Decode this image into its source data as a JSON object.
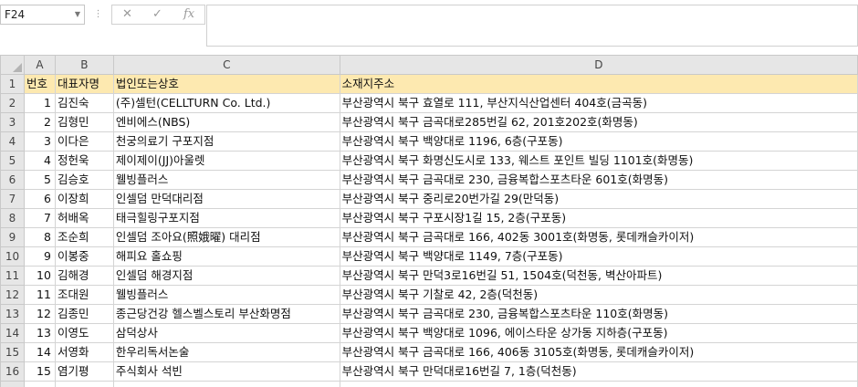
{
  "namebox": {
    "value": "F24"
  },
  "formula": {
    "cancel_icon": "✕",
    "enter_icon": "✓",
    "fx_label": "fx",
    "value": ""
  },
  "columns": [
    "A",
    "B",
    "C",
    "D"
  ],
  "header": [
    "번호",
    "대표자명",
    "법인또는상호",
    "소재지주소"
  ],
  "rows": [
    {
      "n": "2",
      "a": "1",
      "b": "김진숙",
      "c": "(주)셀턴(CELLTURN Co. Ltd.)",
      "d": "부산광역시 북구 효열로 111, 부산지식산업센터 404호(금곡동)"
    },
    {
      "n": "3",
      "a": "2",
      "b": "김형민",
      "c": "엔비에스(NBS)",
      "d": "부산광역시 북구 금곡대로285번길 62, 201호202호(화명동)"
    },
    {
      "n": "4",
      "a": "3",
      "b": "이다은",
      "c": "천궁의료기 구포지점",
      "d": "부산광역시 북구 백양대로 1196, 6층(구포동)"
    },
    {
      "n": "5",
      "a": "4",
      "b": "정헌욱",
      "c": "제이제이(JJ)아울렛",
      "d": "부산광역시 북구 화명신도시로 133, 웨스트 포인트 빌딩 1101호(화명동)"
    },
    {
      "n": "6",
      "a": "5",
      "b": "김승호",
      "c": "웰빙플러스",
      "d": "부산광역시 북구 금곡대로 230, 금융복합스포츠타운 601호(화명동)"
    },
    {
      "n": "7",
      "a": "6",
      "b": "이장희",
      "c": "인셀덤 만덕대리점",
      "d": "부산광역시 북구 중리로20번가길 29(만덕동)"
    },
    {
      "n": "8",
      "a": "7",
      "b": "허배옥",
      "c": "태극힐링구포지점",
      "d": "부산광역시 북구 구포시장1길 15, 2층(구포동)"
    },
    {
      "n": "9",
      "a": "8",
      "b": "조순희",
      "c": "인셀덤 조아요(照娥曜) 대리점",
      "d": "부산광역시 북구 금곡대로 166, 402동 3001호(화명동, 롯데캐슬카이저)"
    },
    {
      "n": "10",
      "a": "9",
      "b": "이봉중",
      "c": "해피요 홀쇼핑",
      "d": "부산광역시 북구 백양대로 1149, 7층(구포동)"
    },
    {
      "n": "11",
      "a": "10",
      "b": "김해경",
      "c": "인셀덤 해경지점",
      "d": "부산광역시 북구 만덕3로16번길 51, 1504호(덕천동, 벽산아파트)"
    },
    {
      "n": "12",
      "a": "11",
      "b": "조대원",
      "c": "웰빙플러스",
      "d": "부산광역시 북구 기찰로 42, 2층(덕천동)"
    },
    {
      "n": "13",
      "a": "12",
      "b": "김종민",
      "c": "종근당건강 헬스벨스토리 부산화명점",
      "d": "부산광역시 북구 금곡대로 230, 금융복합스포츠타운 110호(화명동)"
    },
    {
      "n": "14",
      "a": "13",
      "b": "이영도",
      "c": "삼덕상사",
      "d": "부산광역시 북구 백양대로 1096, 에이스타운 상가동 지하층(구포동)"
    },
    {
      "n": "15",
      "a": "14",
      "b": "서영화",
      "c": "한우리독서논술",
      "d": "부산광역시 북구 금곡대로 166, 406동 3105호(화명동, 롯데캐슬카이저)"
    },
    {
      "n": "16",
      "a": "15",
      "b": "염기평",
      "c": "주식회사 석빈",
      "d": "부산광역시 북구 만덕대로16번길 7, 1층(덕천동)"
    }
  ]
}
